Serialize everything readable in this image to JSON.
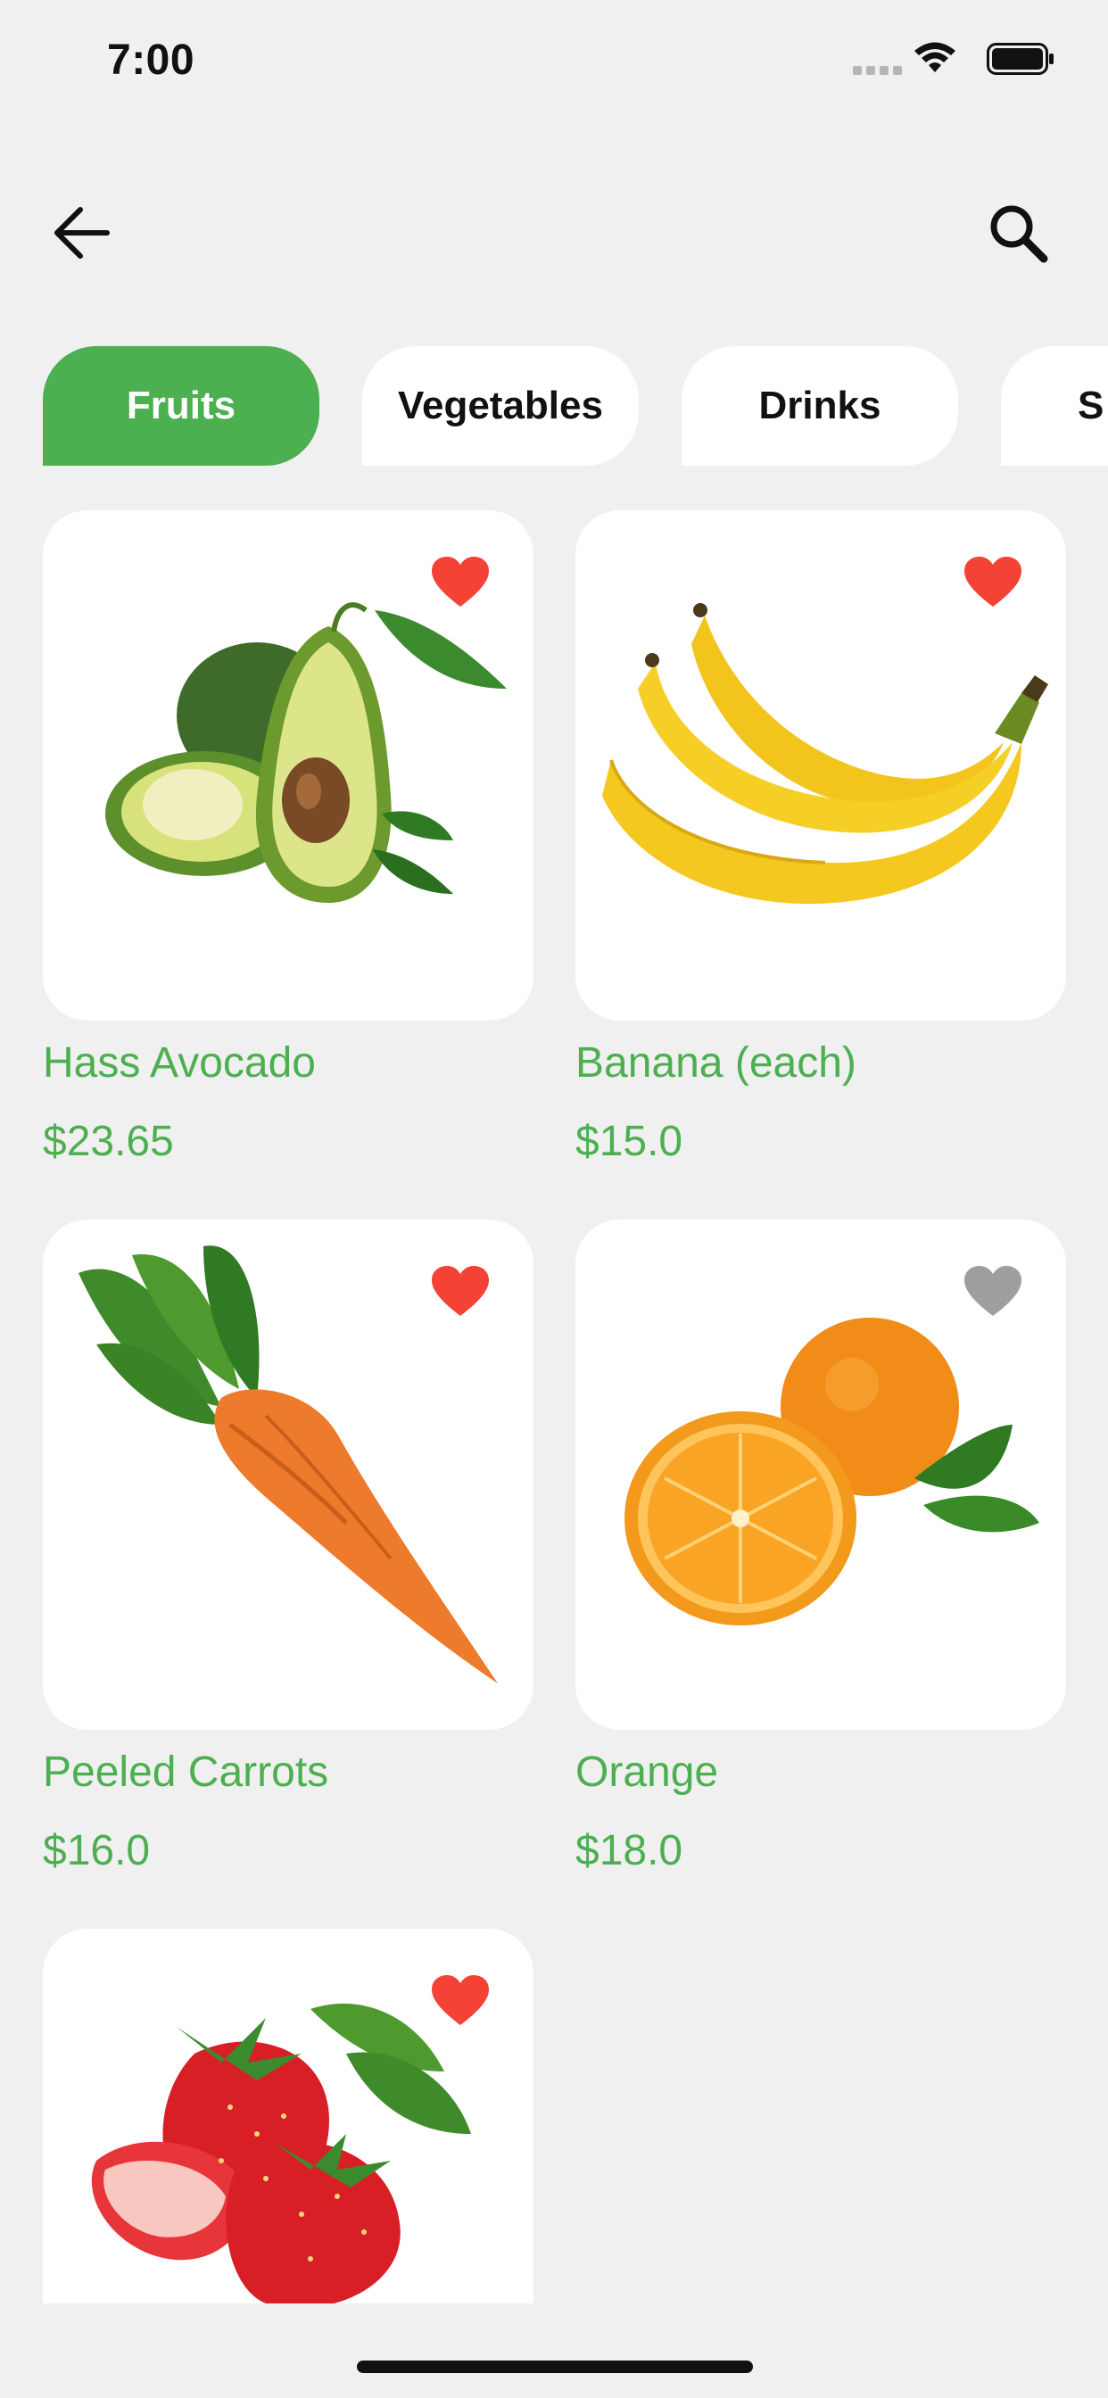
{
  "status": {
    "time": "7:00"
  },
  "colors": {
    "accent": "#4caf50",
    "favorite": "#f44336",
    "not_favorite": "#9e9e9e"
  },
  "header": {
    "back_icon": "arrow-left-icon",
    "search_icon": "search-icon"
  },
  "tabs": [
    {
      "label": "Fruits",
      "active": true
    },
    {
      "label": "Vegetables",
      "active": false
    },
    {
      "label": "Drinks",
      "active": false
    },
    {
      "label": "S",
      "active": false
    }
  ],
  "products": [
    {
      "name": "Hass Avocado",
      "price": "$23.65",
      "favorite": true,
      "image": "avocado"
    },
    {
      "name": "Banana (each)",
      "price": "$15.0",
      "favorite": true,
      "image": "banana"
    },
    {
      "name": "Peeled Carrots",
      "price": "$16.0",
      "favorite": true,
      "image": "carrot"
    },
    {
      "name": "Orange",
      "price": "$18.0",
      "favorite": false,
      "image": "orange"
    },
    {
      "name": "",
      "price": "",
      "favorite": true,
      "image": "strawberry"
    }
  ]
}
